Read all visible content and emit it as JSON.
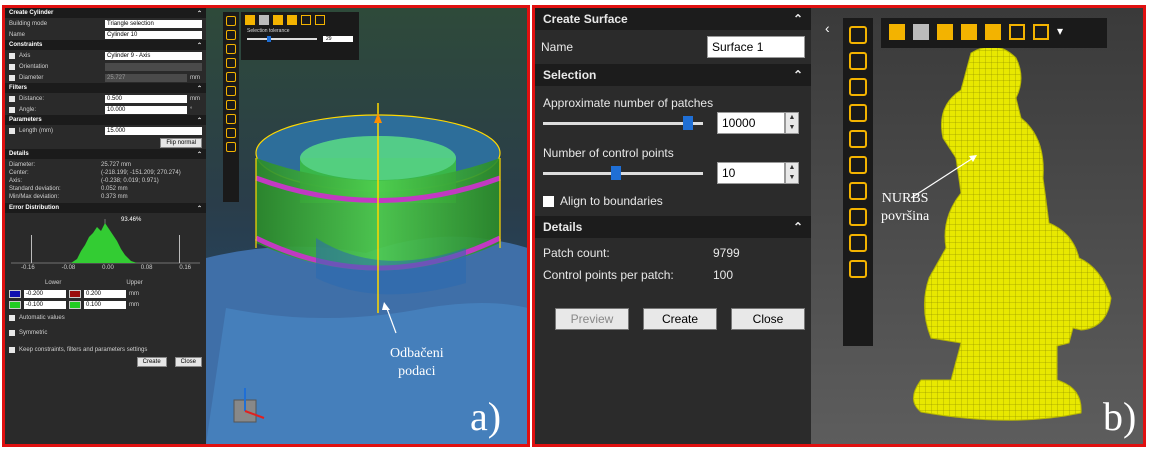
{
  "left": {
    "create_title": "Create Cylinder",
    "building_mode_label": "Building mode",
    "building_mode_value": "Triangle selection",
    "name_label": "Name",
    "name_value": "Cylinder 10",
    "constraints_title": "Constraints",
    "axis_label": "Axis",
    "axis_value": "Cylinder 9 - Axis",
    "orientation_label": "Orientation",
    "diameter_label": "Diameter",
    "diameter_value": "25.727",
    "unit_mm": "mm",
    "filters_title": "Filters",
    "distance_label": "Distance:",
    "distance_value": "0.500",
    "angle_label": "Angle:",
    "angle_value": "10.000",
    "angle_unit": "°",
    "parameters_title": "Parameters",
    "length_label": "Length (mm)",
    "length_value": "15.000",
    "flip_normal": "Flip normal",
    "details_title": "Details",
    "details": [
      {
        "label": "Diameter:",
        "value": "25.727 mm"
      },
      {
        "label": "Center:",
        "value": "(-218.199; -151.209; 270.274)"
      },
      {
        "label": "Axis:",
        "value": "(-0.238; 0.019; 0.971)"
      },
      {
        "label": "Standard deviation:",
        "value": "0.052 mm"
      },
      {
        "label": "Min/Max deviation:",
        "value": "0.373 mm"
      }
    ],
    "error_title": "Error Distribution",
    "hist_percent": "93.46%",
    "hist_ticks": [
      "-0.16",
      "-0.08",
      "0.00",
      "0.08",
      "0.16"
    ],
    "lower_label": "Lower",
    "upper_label": "Upper",
    "err_rows": [
      {
        "lower_color": "#1010b0",
        "lower": "-0.200",
        "upper_color": "#9a0b0b",
        "upper": "0.200"
      },
      {
        "lower_color": "#22cc22",
        "lower": "-0.100",
        "upper_color": "#22cc22",
        "upper": "0.100"
      }
    ],
    "automatic_values": "Automatic values",
    "symmetric": "Symmetric",
    "keep_settings": "Keep constraints, filters and parameters settings",
    "create_btn": "Create",
    "close_btn": "Close",
    "selection_tolerance": "Selection tolerance",
    "tolerance_value": "29",
    "annotation": "Odbačeni\npodaci",
    "panel_label": "a)"
  },
  "right": {
    "create_title": "Create Surface",
    "name_label": "Name",
    "name_value": "Surface 1",
    "selection_title": "Selection",
    "patches_label": "Approximate number of patches",
    "patches_value": "10000",
    "patches_level": 0.93,
    "control_label": "Number of control points",
    "control_value": "10",
    "control_level": 0.45,
    "align_label": "Align to boundaries",
    "details_title": "Details",
    "patch_count_label": "Patch count:",
    "patch_count_value": "9799",
    "cpp_label": "Control points per patch:",
    "cpp_value": "100",
    "preview_btn": "Preview",
    "create_btn": "Create",
    "close_btn": "Close",
    "annotation": "NURBS\npovršina",
    "panel_label": "b)"
  },
  "colors": {
    "border": "#e01010",
    "accent_toolbar": "#f3b300",
    "mesh_yellow": "#f0f000",
    "cylinder_green": "#3cc43c",
    "edge_magenta": "#c23ac2",
    "slider_blue": "#1f6fd6"
  }
}
